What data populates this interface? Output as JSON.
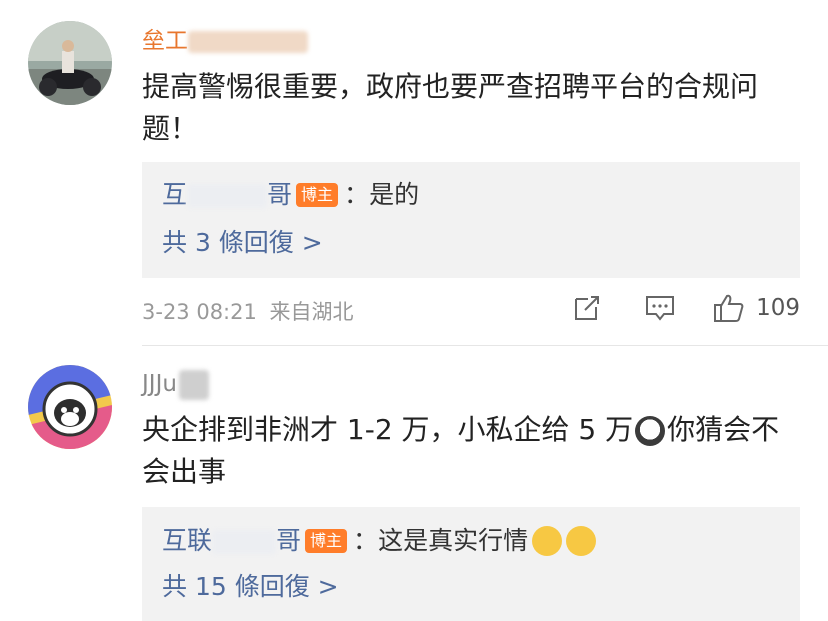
{
  "comments": [
    {
      "username_visible": "垒工",
      "text": "提高警惕很重要，政府也要严查招聘平台的合规问题！",
      "reply": {
        "author_prefix": "互",
        "author_suffix": "哥",
        "badge": "博主",
        "separator": "：",
        "text": "是的"
      },
      "more_replies": "共 3 條回復 >",
      "timestamp": "3-23 08:21",
      "location": "来自湖北",
      "likes": "109"
    },
    {
      "username_visible": "JJJu",
      "text_part1": "央企排到非洲才 1-2 万，小私企给 5 万",
      "text_part2": "你猜会不会出事",
      "reply": {
        "author_prefix": "互联",
        "author_suffix": "哥",
        "badge": "博主",
        "separator": "：",
        "text": "这是真实行情"
      },
      "more_replies": "共 15 條回復 >"
    }
  ],
  "icons": {
    "share": "share-icon",
    "comment": "comment-icon",
    "like": "thumbs-up-icon"
  },
  "colors": {
    "username1": "#e8762d",
    "link": "#4e6a9c",
    "badge": "#ff7d2a",
    "reply_bg": "#f2f2f2",
    "meta": "#999999"
  }
}
